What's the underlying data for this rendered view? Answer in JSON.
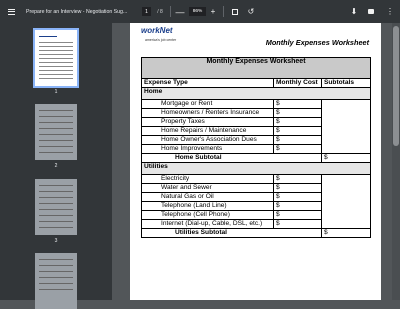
{
  "toolbar": {
    "title": "Prepare for an Interview - Negotiation Sug...",
    "page_current": "1",
    "page_total": "/ 8",
    "zoom_minus": "—",
    "zoom_value": "86%",
    "zoom_plus": "+",
    "rotate_icon": "↺",
    "download_icon": "⬇",
    "more_icon": "⋮"
  },
  "thumbnails": [
    {
      "number": "1"
    },
    {
      "number": "2"
    },
    {
      "number": "3"
    }
  ],
  "page": {
    "logo_main": "workNet",
    "logo_sub": "america's job center",
    "header_title": "Monthly Expenses Worksheet",
    "table_title": "Monthly Expenses Worksheet",
    "col_expense": "Expense Type",
    "col_cost": "Monthly Cost",
    "col_subtotal": "Subtotals",
    "sections": [
      {
        "name": "Home",
        "items": [
          {
            "label": "Mortgage or Rent",
            "cost": "$"
          },
          {
            "label": "Homeowners / Renters Insurance",
            "cost": "$"
          },
          {
            "label": "Property Taxes",
            "cost": "$"
          },
          {
            "label": "Home Repairs / Maintenance",
            "cost": "$"
          },
          {
            "label": "Home Owner's Association Dues",
            "cost": "$"
          },
          {
            "label": "Home Improvements",
            "cost": "$"
          }
        ],
        "subtotal_label": "Home Subtotal",
        "subtotal_value": "$"
      },
      {
        "name": "Utilities",
        "items": [
          {
            "label": "Electricity",
            "cost": "$"
          },
          {
            "label": "Water and Sewer",
            "cost": "$"
          },
          {
            "label": "Natural Gas or Oil",
            "cost": "$"
          },
          {
            "label": "Telephone (Land Line)",
            "cost": "$"
          },
          {
            "label": "Telephone (Cell Phone)",
            "cost": "$"
          },
          {
            "label": "Internet (Dial-up, Cable, DSL, etc.)",
            "cost": "$"
          }
        ],
        "subtotal_label": "Utilities Subtotal",
        "subtotal_value": "$"
      }
    ]
  }
}
